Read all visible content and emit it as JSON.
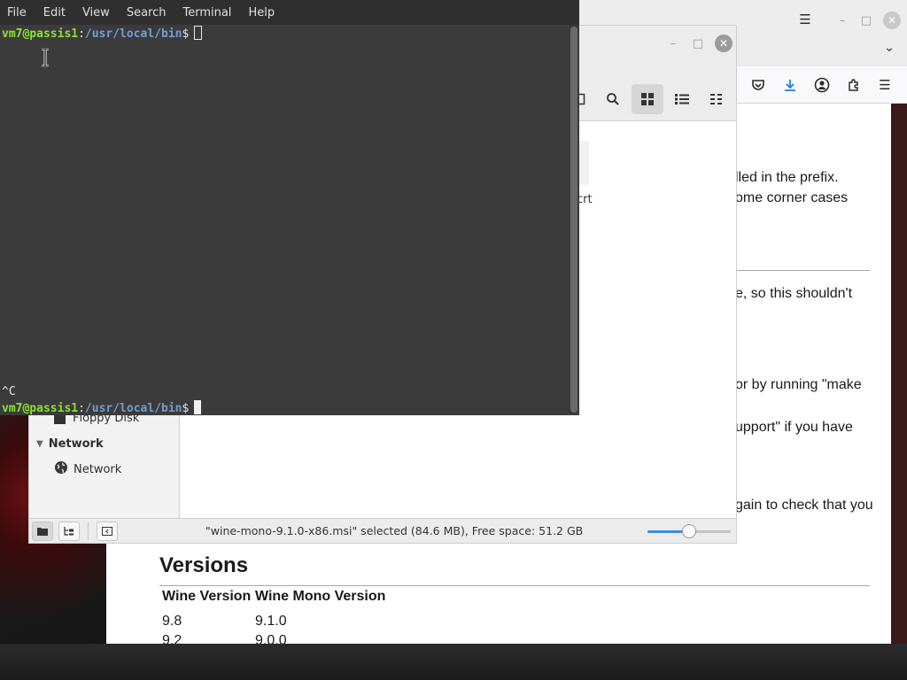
{
  "terminal": {
    "menu": [
      "File",
      "Edit",
      "View",
      "Search",
      "Terminal",
      "Help"
    ],
    "prompt_user": "vm7@passis1",
    "prompt_sep": ":",
    "prompt_path": "/usr/local/bin",
    "prompt_symbol": "$",
    "interrupt_line": "^C"
  },
  "file_manager": {
    "sidebar": {
      "floppy_label": "Floppy Disk",
      "network_section": "Network",
      "network_item": "Network"
    },
    "partial_file_label": "crt",
    "status_text": "\"wine-mono-9.1.0-x86.msi\" selected (84.6 MB), Free space: 51.2 GB",
    "zoom_level": 0.5,
    "icons": {
      "search": "search-icon",
      "grid_view": "grid-view-icon",
      "list_view": "list-view-icon",
      "compact_view": "compact-view-icon"
    }
  },
  "browser": {
    "toolbar_icons": [
      "pocket-icon",
      "download-icon",
      "account-icon",
      "extensions-icon",
      "menu-icon"
    ],
    "partial_lines": [
      "lled in the prefix.",
      "ome corner cases",
      "e, so this shouldn't",
      "or by running \"make",
      "upport\" if you have",
      "gain to check that you"
    ],
    "versions_heading": "Versions",
    "table": {
      "headers": [
        "Wine Version",
        "Wine Mono Version"
      ],
      "rows": [
        [
          "9.8",
          "9.1.0"
        ],
        [
          "9.2",
          "9.0.0"
        ]
      ]
    }
  },
  "colors": {
    "accent": "#3b8ed8",
    "prompt_user": "#8ae234",
    "prompt_path": "#729fcf",
    "terminal_bg": "#3b3b3b"
  }
}
